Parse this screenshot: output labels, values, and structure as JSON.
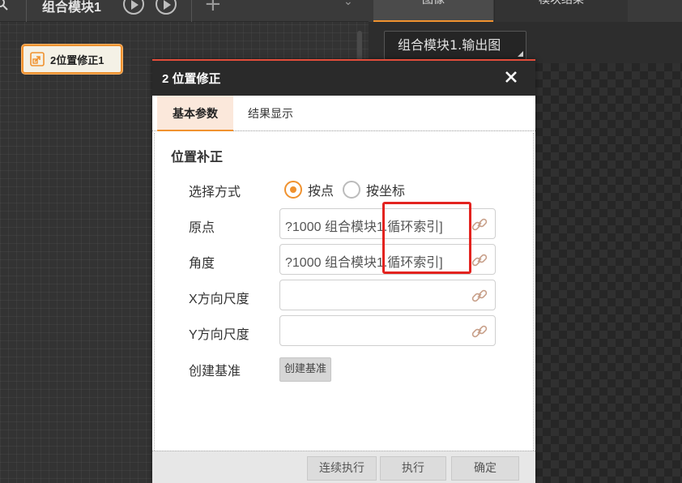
{
  "flow_tab": {
    "title": "组合模块1"
  },
  "flow_node": {
    "label": "2位置修正1"
  },
  "image_tabs": [
    "图像",
    "模块结果"
  ],
  "image_select": {
    "value": "组合模块1.输出图"
  },
  "dialog": {
    "title": "2 位置修正",
    "tabs": [
      "基本参数",
      "结果显示"
    ],
    "section_title": "位置补正",
    "fields": {
      "select_mode": {
        "label": "选择方式",
        "options": [
          "按点",
          "按坐标"
        ],
        "selected": "按点"
      },
      "origin": {
        "label": "原点",
        "value": "?1000 组合模块1.循环索引]"
      },
      "angle": {
        "label": "角度",
        "value": "?1000 组合模块1.循环索引]"
      },
      "x_scale": {
        "label": "X方向尺度",
        "value": ""
      },
      "y_scale": {
        "label": "Y方向尺度",
        "value": ""
      },
      "create_base": {
        "label": "创建基准",
        "button": "创建基准"
      }
    },
    "footer": {
      "continuous_run": "连续执行",
      "run": "执行",
      "ok": "确定"
    }
  },
  "colors": {
    "accent": "#f0922f",
    "dialog_top_border": "#e24c3a",
    "highlight_box": "#e3231f"
  }
}
